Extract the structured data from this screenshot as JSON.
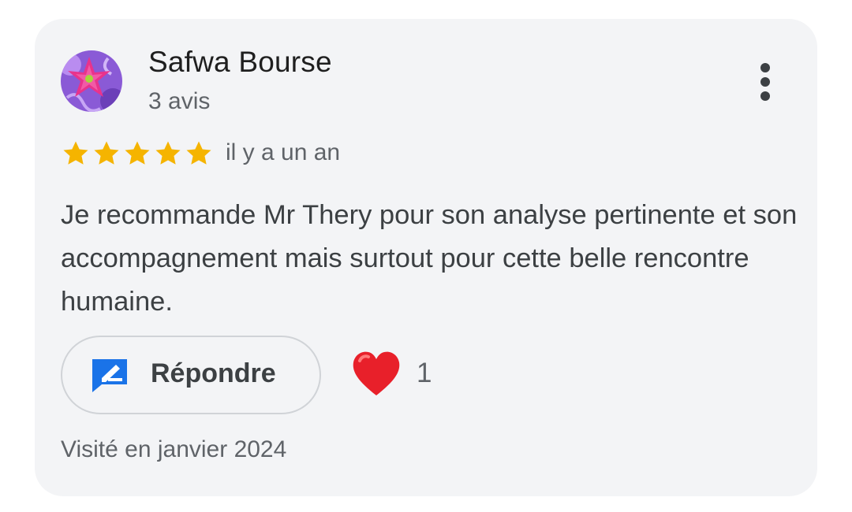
{
  "review": {
    "reviewer": {
      "name": "Safwa Bourse",
      "review_count": "3 avis",
      "avatar_icon": "flower-avatar"
    },
    "rating": {
      "value": 5,
      "max": 5
    },
    "date": "il y a un an",
    "text": "Je recommande Mr Thery pour son analyse pertinente et son accompagnement mais surtout pour cette belle rencontre humaine.",
    "actions": {
      "reply_label": "Répondre",
      "reply_icon": "reply-icon",
      "like_icon": "heart-icon",
      "like_count": "1",
      "more_icon": "more-vert-icon"
    },
    "visit": "Visité en janvier 2024"
  },
  "colors": {
    "card_background": "#f3f4f6",
    "star": "#f5b400",
    "reply_icon": "#1a73e8",
    "heart": "#e8202a"
  }
}
